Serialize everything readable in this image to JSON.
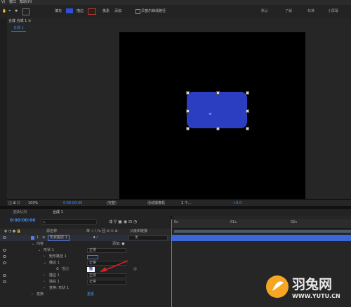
{
  "menu": [
    "V)",
    "窗口",
    "帮助(H)"
  ],
  "toolbar": {
    "fill_label": "填充",
    "stroke_label": "描边",
    "px_label": "像素",
    "add_label": "添加",
    "bezier_label": "贝塞尔曲线路径",
    "workspaces": [
      "默认",
      "了解",
      "标准",
      "小屏幕"
    ],
    "fill_color": "#2e50d6",
    "stroke_color": "#c0392b"
  },
  "comp": {
    "panel_title": "合成 合成 1 ≡",
    "tab": "合成 1"
  },
  "viewer": {
    "zoom": "100%",
    "timecode": "0:00:00:00",
    "resolution": "(完整)",
    "camera": "活动摄像机",
    "views": "1 个…",
    "exposure": "+0.0"
  },
  "timeline": {
    "render_queue": "渲染队列",
    "tab": "合成 1",
    "timecode": "0:00:00:00",
    "search_placeholder": "ρ.",
    "columns": {
      "source_name": "源名称",
      "switches": "单 ☆ \\ fx 回 ⊘ ⊙ ⊕",
      "parent": "父级和链接"
    },
    "ruler_ticks": [
      "0s",
      "01s",
      "02s"
    ],
    "layer": {
      "number": "1",
      "name": "形状图层 1",
      "parent": "无"
    },
    "rows": [
      {
        "label": "内容",
        "extra": "添加: ●"
      },
      {
        "label": "形状 1",
        "value": "正常"
      },
      {
        "label": "矩形路径 1",
        "value": ""
      },
      {
        "label": "描边 1",
        "value": "正常"
      },
      {
        "label": "描边",
        "value": "描"
      },
      {
        "label": "描边 1",
        "value": "正常"
      },
      {
        "label": "填充 1",
        "value": "正常"
      },
      {
        "label": "变换: 形状 1",
        "value": ""
      },
      {
        "label": "变换",
        "value": "重置"
      }
    ]
  },
  "watermark": {
    "brand": "羽兔网",
    "url": "WWW.YUTU.CN"
  }
}
